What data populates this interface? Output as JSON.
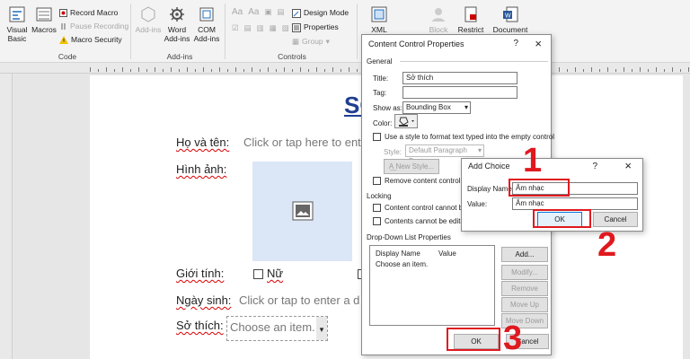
{
  "ribbon": {
    "visual_basic": "Visual Basic",
    "macros": "Macros",
    "record_macro": "Record Macro",
    "pause_recording": "Pause Recording",
    "macro_security": "Macro Security",
    "code_group": "Code",
    "add_ins": "Add-ins",
    "word_add_ins": "Word Add-ins",
    "com_add_ins": "COM Add-ins",
    "add_ins_group": "Add-ins",
    "design_mode": "Design Mode",
    "properties": "Properties",
    "group": "Group",
    "controls_group": "Controls",
    "xml_mapping": "XML Mapping",
    "block": "Block",
    "restrict": "Restrict",
    "document": "Document"
  },
  "doc": {
    "title_fragment": "SỞ",
    "name_label": "Họ và tên:",
    "name_placeholder": "Click or tap here to ente",
    "image_label": "Hình ảnh:",
    "gender_label": "Giới tính:",
    "gender_option": "Nữ",
    "birth_label": "Ngày sinh:",
    "birth_placeholder": "Click or tap to enter a d",
    "hobby_label": "Sở thích:",
    "hobby_value": "Choose an item."
  },
  "ccp": {
    "title": "Content Control Properties",
    "help": "?",
    "close": "×",
    "general": "General",
    "title_label": "Title:",
    "title_value": "Sở thích",
    "tag_label": "Tag:",
    "tag_value": "",
    "show_as_label": "Show as:",
    "show_as_value": "Bounding Box",
    "color_label": "Color:",
    "use_style": "Use a style to format text typed into the empty control",
    "style_label": "Style:",
    "style_value": "Default Paragraph Font",
    "new_style": "New Style...",
    "remove_when": "Remove content control wh",
    "locking": "Locking",
    "lock_delete": "Content control cannot be d",
    "lock_edit": "Contents cannot be edited",
    "dropdown_props": "Drop-Down List Properties",
    "col_display": "Display Name",
    "col_value": "Value",
    "list_items": [
      {
        "display": "Choose an item.",
        "value": ""
      }
    ],
    "add": "Add...",
    "modify": "Modify...",
    "remove": "Remove",
    "move_up": "Move Up",
    "move_down": "Move Down",
    "ok": "OK",
    "cancel": "Cancel"
  },
  "add_choice": {
    "title": "Add Choice",
    "help": "?",
    "close": "×",
    "display_label": "Display Name:",
    "display_value": "Âm nhạc",
    "value_label": "Value:",
    "value_value": "Âm nhạc",
    "ok": "OK",
    "cancel": "Cancel"
  },
  "steps": {
    "one": "1",
    "two": "2",
    "three": "3"
  },
  "colors": {
    "accent_red": "#e0191f",
    "title_blue": "#1f3f8f"
  }
}
